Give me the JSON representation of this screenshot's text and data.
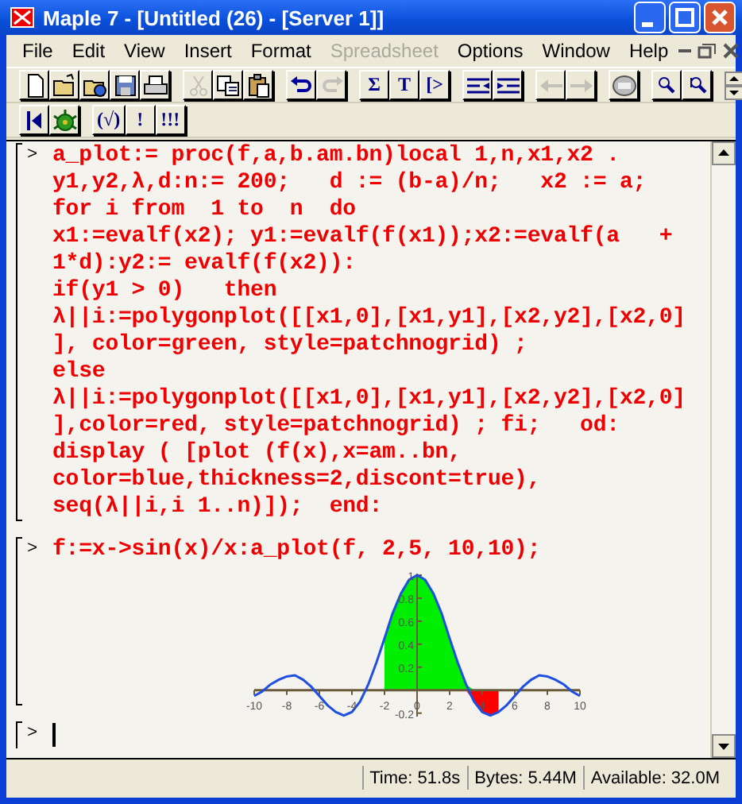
{
  "window": {
    "title": "Maple 7  - [Untitled (26) - [Server 1]]"
  },
  "menu": [
    {
      "label": "File",
      "disabled": false
    },
    {
      "label": "Edit",
      "disabled": false
    },
    {
      "label": "View",
      "disabled": false
    },
    {
      "label": "Insert",
      "disabled": false
    },
    {
      "label": "Format",
      "disabled": false
    },
    {
      "label": "Spreadsheet",
      "disabled": true
    },
    {
      "label": "Options",
      "disabled": false
    },
    {
      "label": "Window",
      "disabled": false
    },
    {
      "label": "Help",
      "disabled": false
    }
  ],
  "toolbar": [
    [
      {
        "kind": "new",
        "disabled": false
      },
      {
        "kind": "open",
        "disabled": false
      },
      {
        "kind": "open-url",
        "disabled": false
      },
      {
        "kind": "save",
        "disabled": false
      },
      {
        "kind": "print",
        "disabled": false
      }
    ],
    [
      {
        "kind": "cut",
        "disabled": true
      },
      {
        "kind": "copy",
        "disabled": false
      },
      {
        "kind": "paste",
        "disabled": false
      }
    ],
    [
      {
        "kind": "undo",
        "disabled": false
      },
      {
        "kind": "redo",
        "disabled": true
      }
    ],
    [
      {
        "kind": "text",
        "label": "Σ",
        "disabled": false
      },
      {
        "kind": "text",
        "label": "T",
        "disabled": false
      },
      {
        "kind": "text",
        "label": "[>",
        "disabled": false
      }
    ],
    [
      {
        "kind": "outdent",
        "disabled": false
      },
      {
        "kind": "indent",
        "disabled": false
      }
    ],
    [
      {
        "kind": "back",
        "disabled": true
      },
      {
        "kind": "forward",
        "disabled": true
      }
    ],
    [
      {
        "kind": "stop",
        "disabled": false
      }
    ],
    [
      {
        "kind": "zoom-in",
        "disabled": false
      },
      {
        "kind": "zoom-out",
        "disabled": false
      }
    ]
  ],
  "context_bar": [
    [
      {
        "kind": "restart",
        "disabled": false
      },
      {
        "kind": "debug",
        "disabled": false
      }
    ],
    [
      {
        "kind": "text",
        "label": "(√)",
        "disabled": false
      },
      {
        "kind": "text",
        "label": "!",
        "disabled": false
      },
      {
        "kind": "text",
        "label": "!!!",
        "disabled": false
      }
    ]
  ],
  "worksheet": {
    "groups": [
      {
        "prompt": ">",
        "lines": [
          "a_plot:= proc(f,a,b.am.bn)local 1,n,x1,x2 .",
          "y1,y2,λ,d:n:= 200;   d := (b-a)/n;   x2 := a;",
          "for i from  1 to  n  do",
          "x1:=evalf(x2); y1:=evalf(f(x1));x2:=evalf(a   +",
          "1*d):y2:= evalf(f(x2)):",
          "if(y1 > 0)   then",
          "λ||i:=polygonplot([[x1,0],[x1,y1],[x2,y2],[x2,0]",
          "], color=green, style=patchnogrid) ;",
          "else",
          "λ||i:=polygonplot([[x1,0],[x1,y1],[x2,y2],[x2,0]",
          "],color=red, style=patchnogrid) ; fi;   od:",
          "display ( [plot (f(x),x=am..bn,",
          "color=blue,thickness=2,discont=true),",
          "seq(λ||i,i 1..n)]);  end:"
        ]
      },
      {
        "prompt": ">",
        "lines": [
          "f:=x->sin(x)/x:a_plot(f, 2,5, 10,10);"
        ],
        "chart_data": {
          "type": "line",
          "x": [
            -10,
            -9.5,
            -9,
            -8.5,
            -8,
            -7.5,
            -7,
            -6.5,
            -6,
            -5.5,
            -5,
            -4.5,
            -4,
            -3.5,
            -3,
            -2.5,
            -2,
            -1.5,
            -1,
            -0.5,
            0,
            0.5,
            1,
            1.5,
            2,
            2.5,
            3,
            3.5,
            4,
            4.5,
            5,
            5.5,
            6,
            6.5,
            7,
            7.5,
            8,
            8.5,
            9,
            9.5,
            10
          ],
          "series": [
            {
              "type": "line",
              "color": "#1f4fe0",
              "values": [
                -0.05,
                -0.01,
                0.05,
                0.09,
                0.12,
                0.13,
                0.09,
                0.03,
                -0.05,
                -0.13,
                -0.19,
                -0.22,
                -0.19,
                -0.1,
                0.05,
                0.24,
                0.45,
                0.67,
                0.84,
                0.96,
                1,
                0.96,
                0.84,
                0.67,
                0.45,
                0.24,
                0.05,
                -0.1,
                -0.19,
                -0.22,
                -0.19,
                -0.13,
                -0.05,
                0.03,
                0.09,
                0.13,
                0.12,
                0.09,
                0.05,
                -0.01,
                -0.05
              ]
            },
            {
              "type": "area",
              "color": "#00ee00",
              "values": [
                null,
                null,
                null,
                null,
                null,
                null,
                null,
                null,
                null,
                null,
                null,
                null,
                null,
                null,
                null,
                null,
                0.45,
                0.67,
                0.84,
                0.96,
                1,
                0.96,
                0.84,
                0.67,
                0.45,
                0.24,
                0.05,
                0,
                null,
                null,
                null,
                null,
                null,
                null,
                null,
                null,
                null,
                null,
                null,
                null,
                null
              ]
            },
            {
              "type": "area",
              "color": "#ff0000",
              "values": [
                null,
                null,
                null,
                null,
                null,
                null,
                null,
                null,
                null,
                null,
                null,
                null,
                null,
                null,
                null,
                null,
                null,
                null,
                null,
                null,
                null,
                null,
                null,
                null,
                null,
                null,
                0,
                -0.1,
                -0.19,
                -0.22,
                -0.19,
                null,
                null,
                null,
                null,
                null,
                null,
                null,
                null,
                null,
                null
              ]
            }
          ],
          "xlim": [
            -10,
            10
          ],
          "ylim": [
            -0.23,
            1
          ],
          "xticks": [
            -10,
            -8,
            -6,
            -4,
            -2,
            0,
            2,
            4,
            6,
            8,
            10
          ],
          "yticks": [
            -0.2,
            0.2,
            0.4,
            0.6,
            0.8,
            1
          ]
        }
      },
      {
        "prompt": ">",
        "cursor": true
      }
    ]
  },
  "status_bar": {
    "time": "Time:  51.8s",
    "bytes": "Bytes: 5.44M",
    "available": "Available: 32.0M"
  }
}
